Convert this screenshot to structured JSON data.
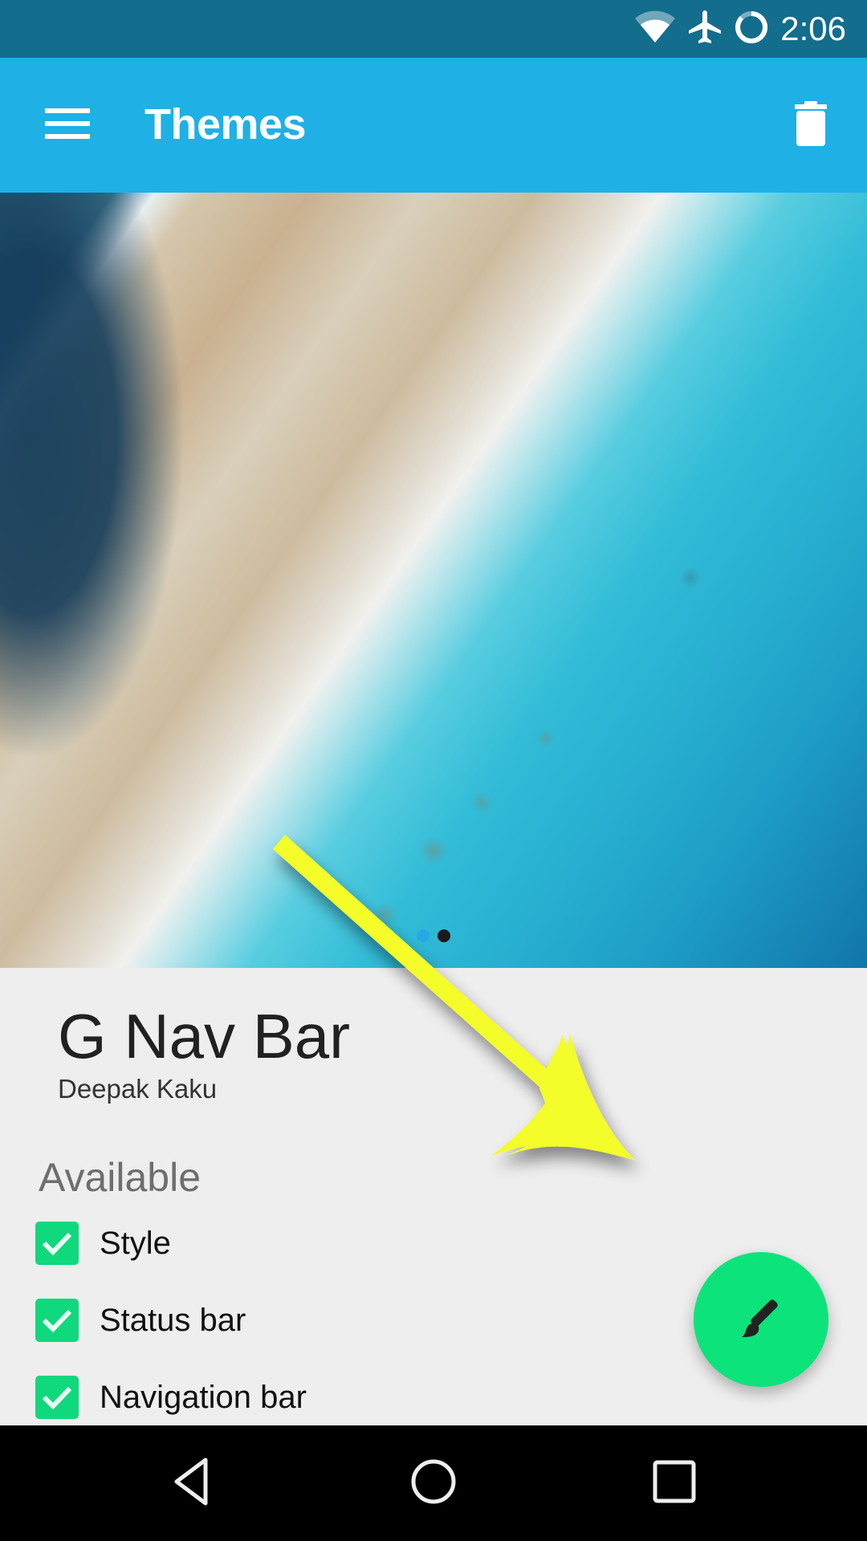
{
  "status_bar": {
    "time": "2:06",
    "icons": [
      "wifi-icon",
      "airplane-mode-icon",
      "battery-saver-ring-icon"
    ]
  },
  "app_bar": {
    "title": "Themes",
    "menu_icon": "hamburger-menu-icon",
    "action_icon": "trash-icon"
  },
  "hero": {
    "description": "aerial coral reef beach preview image",
    "page_count": 2,
    "current_page": 1,
    "colors": {
      "active_dot": "#29a8e6",
      "inactive_dot": "#1a1a1a"
    }
  },
  "theme": {
    "name": "G Nav Bar",
    "author": "Deepak Kaku"
  },
  "available": {
    "heading": "Available",
    "items": [
      {
        "label": "Style",
        "checked": true
      },
      {
        "label": "Status bar",
        "checked": true
      },
      {
        "label": "Navigation bar",
        "checked": true
      }
    ]
  },
  "fab": {
    "icon": "paintbrush-icon",
    "color": "#0de37b"
  },
  "annotation": {
    "type": "yellow-arrow",
    "color": "#f4fc2a",
    "points_to": "apply-theme-fab"
  },
  "nav_bar": {
    "buttons": [
      "back",
      "home",
      "recents"
    ]
  },
  "colors": {
    "status_bar": "#136d8d",
    "app_bar": "#1fb0e6",
    "checkbox": "#10d87c",
    "background": "#eeeeee"
  }
}
